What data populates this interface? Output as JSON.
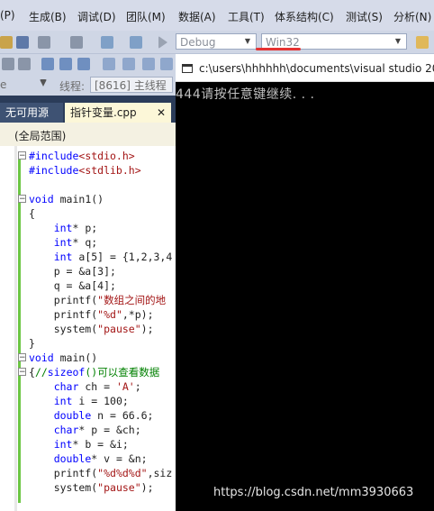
{
  "menubar": {
    "items": [
      "(P)",
      "生成(B)",
      "调试(D)",
      "团队(M)",
      "数据(A)",
      "工具(T)",
      "体系结构(C)",
      "测试(S)",
      "分析(N)"
    ]
  },
  "toolbar": {
    "config_value": "Debug",
    "platform_value": "Win32"
  },
  "threadbar": {
    "prefix": "e",
    "label": "线程:",
    "thread_value": "[8616] 主线程"
  },
  "tabs": {
    "inactive_label": "无可用源",
    "active_label": "指针变量.cpp",
    "close_glyph": "✕"
  },
  "scope": {
    "label": "(全局范围)"
  },
  "editor": {
    "lines": [
      "#include<stdio.h>",
      "#include<stdlib.h>",
      "",
      "void main1()",
      "{",
      "    int* p;",
      "    int* q;",
      "    int a[5] = {1,2,3,4",
      "    p = &a[3];",
      "    q = &a[4];",
      "    printf(\"数组之间的地",
      "    printf(\"%d\",*p);",
      "    system(\"pause\");",
      "}",
      "void main()",
      "{//sizeof()可以查看数据",
      "    char ch = 'A';",
      "    int i = 100;",
      "    double n = 66.6;",
      "    char* p = &ch;",
      "    int* b = &i;",
      "    double* v = &n;",
      "    printf(\"%d%d%d\",siz",
      "    system(\"pause\");"
    ]
  },
  "console": {
    "title": "c:\\users\\hhhhhh\\documents\\visual studio 201",
    "output": "444请按任意键继续. . ."
  },
  "watermark": {
    "text": "https://blog.csdn.net/mm3930663"
  },
  "colors": {
    "keyword": "#0000ff",
    "string": "#a31515",
    "comment": "#008000",
    "annotation_underline": "#e53232"
  }
}
